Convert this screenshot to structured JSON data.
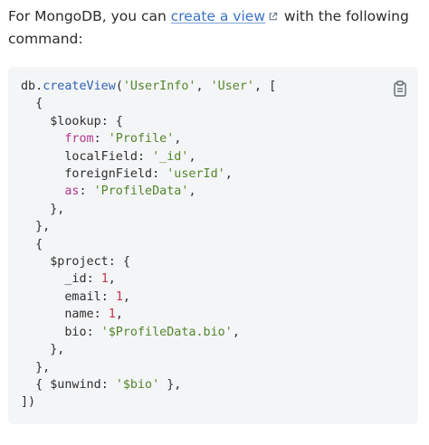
{
  "intro": {
    "before_link": "For MongoDB, you can ",
    "link_text": "create a view",
    "after_link": " with the following command:"
  },
  "icons": {
    "external_link": "external-link-icon",
    "copy": "clipboard-icon"
  },
  "colors": {
    "link": "#3a72c4",
    "code_background": "#f4f5f7",
    "string": "#53862a",
    "number": "#c8324a",
    "keyword": "#b3368f",
    "function": "#2f63b0"
  },
  "code": {
    "db": "db",
    "method": "createView",
    "view_name": "'UserInfo'",
    "source_collection": "'User'",
    "lookup_stage": "$lookup",
    "from_key": "from",
    "from_value": "'Profile'",
    "local_field_key": "localField",
    "local_field_value": "'_id'",
    "foreign_field_key": "foreignField",
    "foreign_field_value": "'userId'",
    "as_key": "as",
    "as_value": "'ProfileData'",
    "project_stage": "$project",
    "id_key": "_id",
    "id_value": "1",
    "email_key": "email",
    "email_value": "1",
    "name_key": "name",
    "name_value": "1",
    "bio_key": "bio",
    "bio_value": "'$ProfileData.bio'",
    "unwind_stage": "$unwind",
    "unwind_value": "'$bio'"
  }
}
